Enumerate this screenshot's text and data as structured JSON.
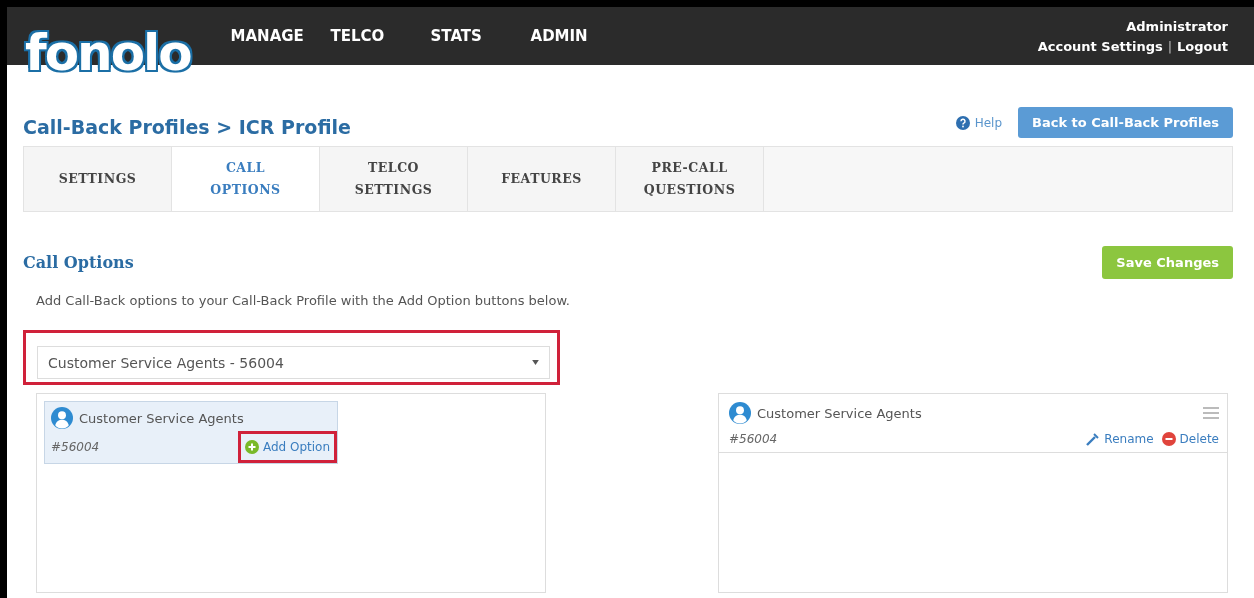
{
  "header": {
    "logo": "fonolo",
    "nav": [
      {
        "label": "MANAGE"
      },
      {
        "label": "TELCO"
      },
      {
        "label": "STATS"
      },
      {
        "label": "ADMIN"
      }
    ],
    "user": "Administrator",
    "account_settings": "Account Settings",
    "separator": "|",
    "logout": "Logout"
  },
  "page_title": "Call-Back Profiles > ICR Profile",
  "help": "Help",
  "back_button": "Back to Call-Back Profiles",
  "tabs": [
    {
      "lines": [
        "SETTINGS"
      ],
      "selected": false
    },
    {
      "lines": [
        "CALL",
        "OPTIONS"
      ],
      "selected": true
    },
    {
      "lines": [
        "TELCO",
        "SETTINGS"
      ],
      "selected": false
    },
    {
      "lines": [
        "FEATURES"
      ],
      "selected": false
    },
    {
      "lines": [
        "PRE-CALL",
        "QUESTIONS"
      ],
      "selected": false
    }
  ],
  "section_title": "Call Options",
  "save_button": "Save Changes",
  "description": "Add Call-Back options to your Call-Back Profile with the Add Option buttons below.",
  "select": {
    "value": "Customer Service Agents - 56004",
    "highlighted": true
  },
  "left_card": {
    "name": "Customer Service Agents",
    "number": "#56004",
    "add_option": "Add Option",
    "add_highlighted": true
  },
  "right_card": {
    "name": "Customer Service Agents",
    "number": "#56004",
    "rename": "Rename",
    "delete": "Delete"
  }
}
